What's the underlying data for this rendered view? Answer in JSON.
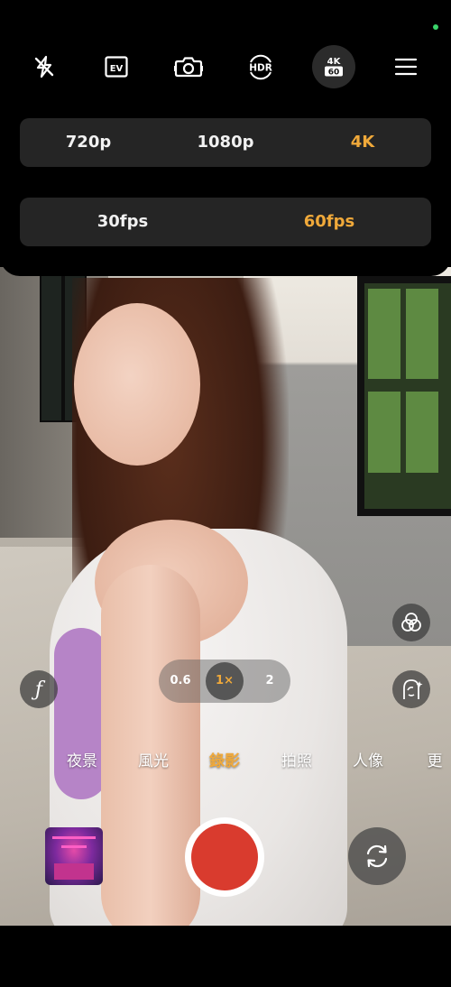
{
  "top_bar": {
    "icons": [
      "flash-off-icon",
      "ev-icon",
      "camera-icon",
      "hdr-icon",
      "resolution-fps-icon",
      "menu-icon"
    ],
    "ev_label": "EV",
    "hdr_label": "HDR",
    "res_badge_top": "4K",
    "res_badge_bottom": "60"
  },
  "resolution": {
    "options": [
      "720p",
      "1080p",
      "4K"
    ],
    "selected": "4K"
  },
  "framerate": {
    "options": [
      "30fps",
      "60fps"
    ],
    "selected": "60fps"
  },
  "zoom": {
    "options": [
      "0.6",
      "1×",
      "2"
    ],
    "selected": "1×"
  },
  "pro_label": "ƒ",
  "modes": {
    "items": [
      "夜景",
      "風光",
      "錄影",
      "拍照",
      "人像",
      "更"
    ],
    "selected": "錄影"
  },
  "colors": {
    "accent": "#f0a93a",
    "record": "#d93b2e",
    "status": "#3ad46a"
  }
}
